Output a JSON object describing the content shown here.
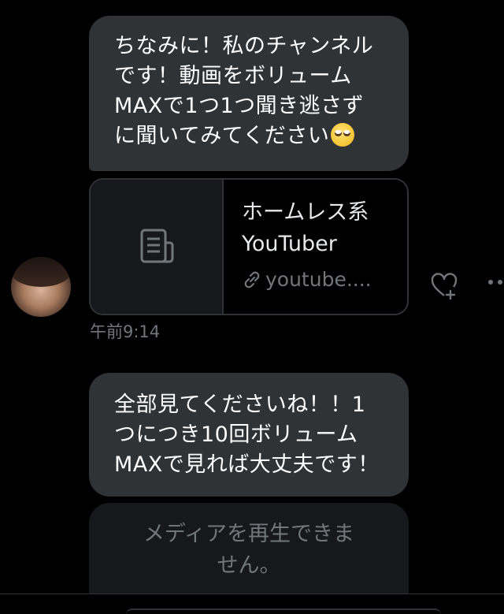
{
  "messages": [
    {
      "lines": [
        "ちなみに！私のチャンネル",
        "です！動画をボリューム",
        "MAXで1つ1つ聞き逃さず",
        "に聞いてみてください"
      ],
      "emoji": "rolling-eyes-emoji"
    },
    {
      "lines": [
        "全部見てくださいね！！1",
        "つにつき10回ボリューム",
        "MAXで見れば大丈夫です！"
      ]
    }
  ],
  "link_card": {
    "title_line1": "ホームレス系",
    "title_line2": "YouTuber",
    "domain": "youtube...."
  },
  "timestamp": "午前9:14",
  "media_box": {
    "line1": "メディアを再生できま",
    "line2": "せん。"
  },
  "icons": {
    "thumb": "document-icon",
    "link": "link-icon",
    "react": "heart-plus-icon",
    "more": "more-icon"
  },
  "colors": {
    "background": "#000000",
    "bubble": "#2f3336",
    "muted_text": "#71767b",
    "text": "#ffffff"
  }
}
